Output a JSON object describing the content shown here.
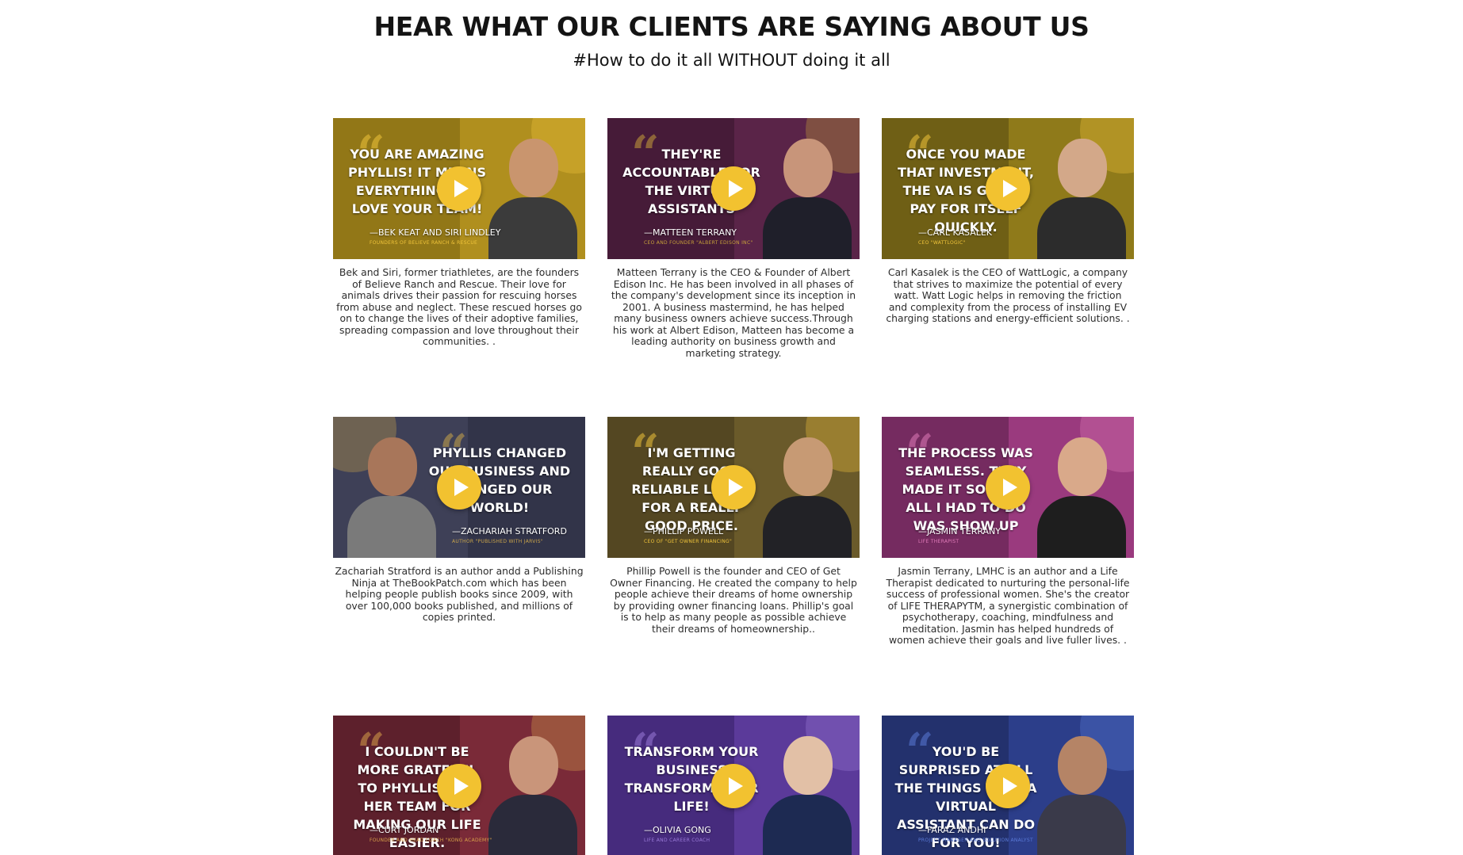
{
  "header": {
    "title": "HEAR WHAT OUR CLIENTS ARE SAYING ABOUT US",
    "subtitle": "#How to do it all WITHOUT doing it all"
  },
  "testimonials": [
    {
      "headline": "YOU ARE AMAZING PHYLLIS! IT MEANS EVERYTHING. WE LOVE YOUR TEAM!",
      "author": "—BEK KEAT AND SIRI LINDLEY",
      "role": "FOUNDERS OF BELIEVE RANCH & RESCUE",
      "description": "Bek and Siri, former triathletes, are the founders of Believe Ranch and Rescue. Their love for animals drives their passion for rescuing horses from abuse and neglect. These rescued horses go on to change the lives of their adoptive families, spreading compassion and love throughout their communities. .",
      "play_icon": "play-icon",
      "colors": {
        "bg": "#b08f1e",
        "accent": "#f0c43b",
        "dark": "#6e5a10",
        "photo": "#c9956e",
        "shirt": "#3b3b3b"
      }
    },
    {
      "headline": "THEY'RE ACCOUNTABLE FOR THE VIRTUAL ASSISTANTS",
      "author": "—MATTEEN TERRANY",
      "role": "CEO AND FOUNDER \"ALBERT EDISON INC\"",
      "description": "Matteen Terrany is the CEO & Founder of Albert Edison Inc. He has been involved in all phases of the company's development since its inception in 2001. A business mastermind, he has helped many business owners achieve success.Through his work at Albert Edison, Matteen has become a leading authority on business growth and marketing strategy.",
      "play_icon": "play-icon",
      "colors": {
        "bg": "#5a2448",
        "accent": "#c7a03a",
        "dark": "#2e1226",
        "photo": "#c8957a",
        "shirt": "#1f1f2a"
      }
    },
    {
      "headline": "ONCE YOU MADE THAT INVESTMENT, THE VA IS GONNA PAY FOR ITSELF QUICKLY.",
      "author": "—CARL KASALEK",
      "role": "CEO \"WATTLOGIC\"",
      "description": "Carl Kasalek is the CEO of WattLogic, a company that strives to maximize the potential of every watt. Watt Logic helps in removing the friction and complexity from the process of installing EV charging stations and energy-efficient solutions. .",
      "play_icon": "play-icon",
      "colors": {
        "bg": "#8f7a1a",
        "accent": "#f0c43b",
        "dark": "#4a3f10",
        "photo": "#d3a889",
        "shirt": "#2c2c2c"
      }
    },
    {
      "headline": "PHYLLIS CHANGED OUR BUSINESS AND CHANGED OUR WORLD!",
      "author": "—ZACHARIAH STRATFORD",
      "role": "AUTHOR \"PUBLISHED WITH JARVIS\"",
      "description": "Zachariah Stratford is an author andd a Publishing Ninja at TheBookPatch.com which has been helping people publish books since 2009, with over 100,000 books published, and millions of copies printed.",
      "play_icon": "play-icon",
      "colors": {
        "bg": "#3e4057",
        "accent": "#c9a44a",
        "dark": "#24253a",
        "photo": "#a8765a",
        "shirt": "#7a7a7a"
      }
    },
    {
      "headline": "I'M GETTING REALLY GOOD RELIABLE LABOR FOR A REALLY GOOD PRICE.",
      "author": "—PHILLIP POWELL",
      "role": "CEO OF \"GET OWNER FINANCING\"",
      "description": "Phillip Powell is the founder and CEO of Get Owner Financing. He created the company to help people achieve their dreams of home ownership by providing owner financing loans. Phillip's goal is to help as many people as possible achieve their dreams of homeownership..",
      "play_icon": "play-icon",
      "colors": {
        "bg": "#6a5a2a",
        "accent": "#f0c43b",
        "dark": "#3a3118",
        "photo": "#c79a74",
        "shirt": "#222226"
      }
    },
    {
      "headline": "THE PROCESS WAS SEAMLESS. THEY MADE IT SO EASY. ALL I HAD TO DO WAS SHOW UP",
      "author": "—JASMIN TERRANY",
      "role": "LIFE THERAPIST",
      "description": "Jasmin Terrany, LMHC is an author and a Life Therapist dedicated to nurturing the personal-life success of professional women. She's the creator of LIFE THERAPYTM, a synergistic combination of psychotherapy, coaching, mindfulness and meditation. Jasmin has helped hundreds of women achieve their goals and live fuller lives. .",
      "play_icon": "play-icon",
      "colors": {
        "bg": "#9a3a7e",
        "accent": "#e07ab8",
        "dark": "#4a1a3c",
        "photo": "#d9a98a",
        "shirt": "#1e1e1e"
      }
    },
    {
      "headline": "I COULDN'T BE MORE GRATEFUL TO PHYLLIS AND HER TEAM FOR MAKING OUR LIFE EASIER.",
      "author": "—CURT JORDAN",
      "role": "FOUNDER AND HEAD COACH \"KONG ACADEMY\"",
      "description": "",
      "play_icon": "play-icon",
      "colors": {
        "bg": "#7a2a38",
        "accent": "#d8a04a",
        "dark": "#3a1420",
        "photo": "#c9957a",
        "shirt": "#2a2a3a"
      }
    },
    {
      "headline": "TRANSFORM YOUR BUSINESS TRANSFORM YOUR LIFE!",
      "author": "—OLIVIA GONG",
      "role": "LIFE AND CAREER COACH",
      "description": "",
      "play_icon": "play-icon",
      "colors": {
        "bg": "#5b3a9a",
        "accent": "#9a7ad8",
        "dark": "#2c1a5a",
        "photo": "#e2c0a6",
        "shirt": "#1d2a52"
      }
    },
    {
      "headline": "YOU'D BE SURPRISED AT ALL THE THINGS THAT A VIRTUAL ASSISTANT CAN DO FOR YOU!",
      "author": "—FARAZ ANDHI",
      "role": "PROJECT MANAGER AND SOLUTION ANALYST",
      "description": "",
      "play_icon": "play-icon",
      "colors": {
        "bg": "#2c3e8a",
        "accent": "#5a7ad8",
        "dark": "#18224a",
        "photo": "#b58466",
        "shirt": "#3a3a4a"
      }
    }
  ]
}
